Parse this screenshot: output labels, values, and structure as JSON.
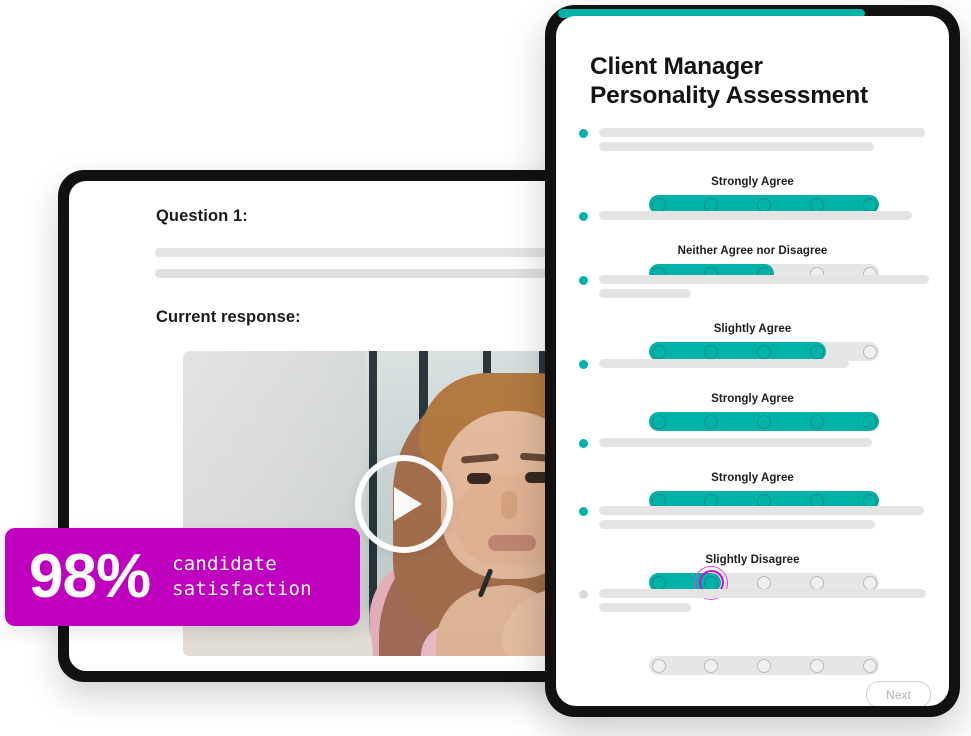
{
  "desktop": {
    "question_label": "Question 1:",
    "response_label": "Current response:",
    "play_icon": "play-icon"
  },
  "badge": {
    "value": "98%",
    "caption_line1": "candidate",
    "caption_line2": "satisfaction",
    "color": "#BF00BF"
  },
  "tablet": {
    "accent_color": "#00B3A8",
    "title_line1": "Client Manager",
    "title_line2": "Personality Assessment",
    "next_label": "Next",
    "questions": [
      {
        "answered": true,
        "label": "Strongly Agree",
        "selected": 5,
        "skeletons": [
          326,
          275
        ]
      },
      {
        "answered": true,
        "label": "Neither Agree nor Disagree",
        "selected": 3,
        "skeletons": [
          313
        ]
      },
      {
        "answered": true,
        "label": "Slightly Agree",
        "selected": 4,
        "skeletons": [
          330,
          92
        ]
      },
      {
        "answered": true,
        "label": "Strongly Agree",
        "selected": 5,
        "skeletons": [
          250
        ]
      },
      {
        "answered": true,
        "label": "Strongly Agree",
        "selected": 5,
        "skeletons": [
          273
        ]
      },
      {
        "answered": true,
        "label": "Slightly Disagree",
        "selected": 2,
        "skeletons": [
          325,
          276
        ],
        "cursor": true
      },
      {
        "answered": false,
        "label": "",
        "selected": 0,
        "skeletons": [
          327,
          92
        ]
      }
    ],
    "scale_points": 5
  }
}
